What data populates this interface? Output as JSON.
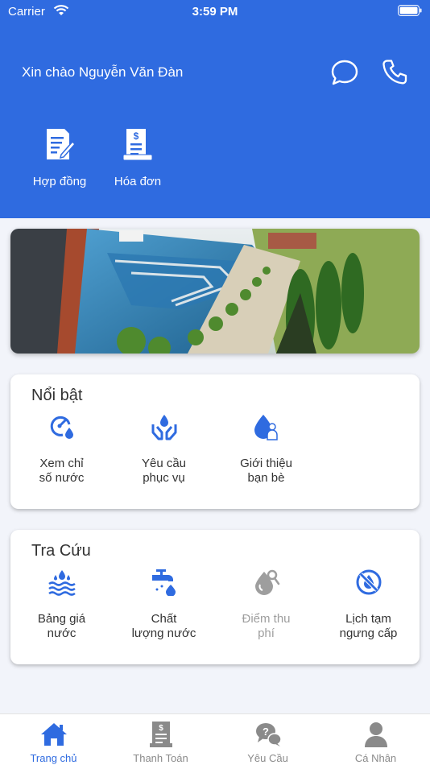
{
  "status_bar": {
    "carrier": "Carrier",
    "time": "3:59 PM"
  },
  "header": {
    "greeting": "Xin chào Nguyễn Văn Đàn"
  },
  "quick_actions": [
    {
      "label": "Hợp đồng",
      "icon": "contract-icon"
    },
    {
      "label": "Hóa đơn",
      "icon": "invoice-icon"
    }
  ],
  "featured": {
    "title": "Nổi bật",
    "items": [
      {
        "label": "Xem chỉ\nsố nước",
        "icon": "meter-icon"
      },
      {
        "label": "Yêu cầu\nphục vụ",
        "icon": "service-request-icon"
      },
      {
        "label": "Giới thiệu\nbạn bè",
        "icon": "refer-friend-icon"
      }
    ]
  },
  "lookup": {
    "title": "Tra Cứu",
    "items": [
      {
        "label": "Bảng giá\nnước",
        "icon": "water-price-icon",
        "disabled": false
      },
      {
        "label": "Chất\nlượng nước",
        "icon": "water-quality-icon",
        "disabled": false
      },
      {
        "label": "Điểm thu\nphí",
        "icon": "collection-point-icon",
        "disabled": true
      },
      {
        "label": "Lịch tạm\nngưng cấp",
        "icon": "suspension-schedule-icon",
        "disabled": false
      }
    ]
  },
  "tabbar": {
    "items": [
      {
        "label": "Trang chủ",
        "icon": "home-icon",
        "active": true
      },
      {
        "label": "Thanh Toán",
        "icon": "payment-icon",
        "active": false
      },
      {
        "label": "Yêu Cầu",
        "icon": "request-icon",
        "active": false
      },
      {
        "label": "Cá Nhân",
        "icon": "profile-icon",
        "active": false
      }
    ]
  },
  "colors": {
    "primary": "#2f6be0",
    "background": "#f2f4fa",
    "inactive": "#8a8a8a"
  }
}
